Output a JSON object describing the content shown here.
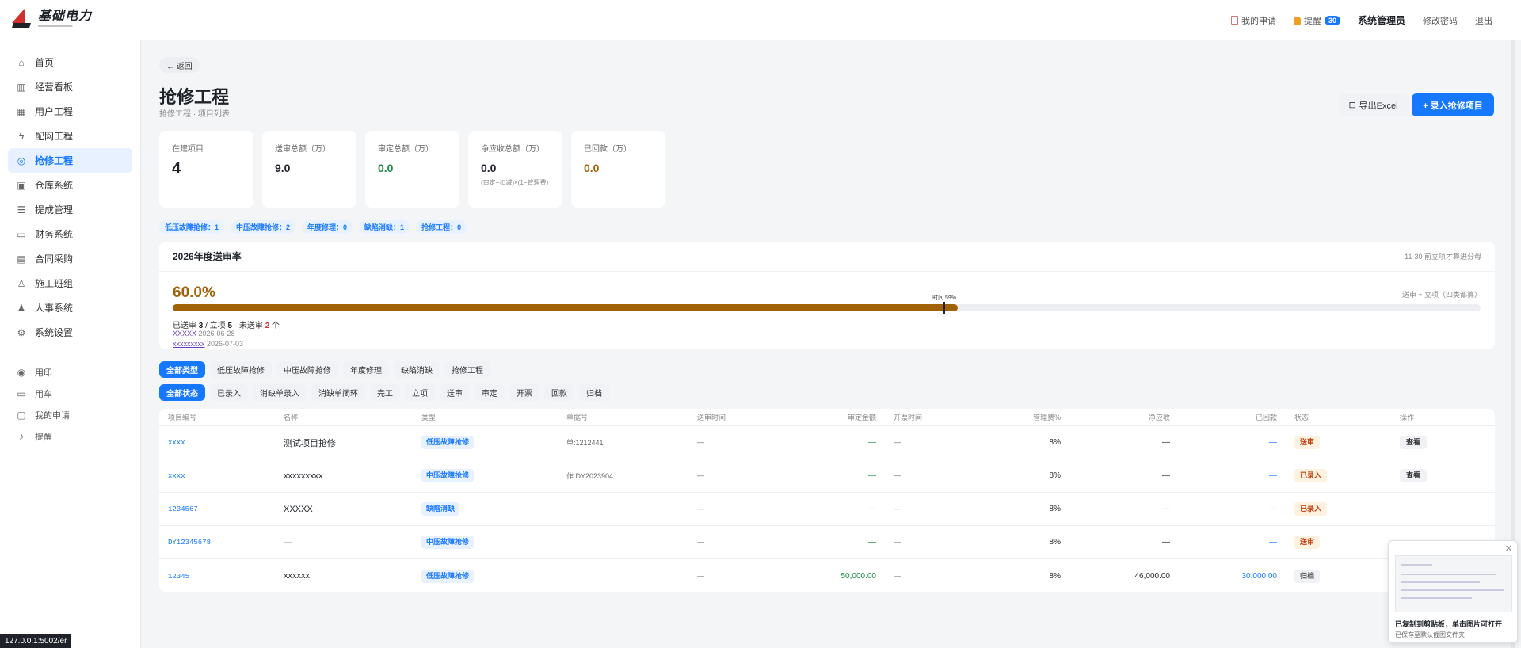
{
  "brand": {
    "name": "基础电力"
  },
  "topbar": {
    "my_requests": "我的申请",
    "reminders": "提醒",
    "reminder_count": "30",
    "user": "系统管理员",
    "change_password": "修改密码",
    "logout": "退出"
  },
  "sidebar": {
    "items": [
      {
        "label": "首页",
        "icon": "home-icon",
        "glyph": "⌂"
      },
      {
        "label": "经营看板",
        "icon": "chart-icon",
        "glyph": "▥"
      },
      {
        "label": "用户工程",
        "icon": "building-icon",
        "glyph": "▦"
      },
      {
        "label": "配网工程",
        "icon": "bolt-icon",
        "glyph": "ϟ"
      },
      {
        "label": "抢修工程",
        "icon": "shield-icon",
        "glyph": "◎"
      },
      {
        "label": "仓库系统",
        "icon": "box-icon",
        "glyph": "▣"
      },
      {
        "label": "提成管理",
        "icon": "list-icon",
        "glyph": "☰"
      },
      {
        "label": "财务系统",
        "icon": "money-icon",
        "glyph": "▭"
      },
      {
        "label": "合同采购",
        "icon": "document-icon",
        "glyph": "▤"
      },
      {
        "label": "施工班组",
        "icon": "team-icon",
        "glyph": "♙"
      },
      {
        "label": "人事系统",
        "icon": "person-add-icon",
        "glyph": "♟"
      },
      {
        "label": "系统设置",
        "icon": "gear-icon",
        "glyph": "⚙"
      }
    ],
    "sub_items": [
      {
        "label": "用印",
        "icon": "seal-icon",
        "glyph": "◉"
      },
      {
        "label": "用车",
        "icon": "car-icon",
        "glyph": "▭"
      },
      {
        "label": "我的申请",
        "icon": "clipboard-icon",
        "glyph": "▢"
      },
      {
        "label": "提醒",
        "icon": "bell-icon",
        "glyph": "♪"
      }
    ]
  },
  "page": {
    "back": "← 返回",
    "title": "抢修工程",
    "subtitle": "抢修工程 · 项目列表",
    "export_label": "导出Excel",
    "add_label": "+ 录入抢修项目"
  },
  "stats": [
    {
      "label": "在建项目",
      "value": "4"
    },
    {
      "label": "送审总额（万）",
      "value": "9.0"
    },
    {
      "label": "审定总额（万）",
      "value": "0.0"
    },
    {
      "label": "净应收总额（万）",
      "value": "0.0",
      "note": "(审定−扣减)×(1−管理费)"
    },
    {
      "label": "已回款（万）",
      "value": "0.0"
    }
  ],
  "chips": [
    "低压故障抢修：1",
    "中压故障抢修：2",
    "年度修理：0",
    "缺陷消缺：1",
    "抢修工程：0"
  ],
  "rate": {
    "title": "2026年度送审率",
    "hint": "11-30 前立项才算进分母",
    "percent": "60.0%",
    "progress_fraction": 0.6,
    "time_fraction": 0.59,
    "time_label": "时间 59%",
    "right_label": "送审 ÷ 立项（四类都算）",
    "summary_prefix": "已送审 ",
    "submitted": "3",
    "summary_mid": " / 立项 ",
    "projects": "5",
    "summary_mid2": " · 未送审 ",
    "pending": "2",
    "summary_suffix": " 个",
    "entries": [
      {
        "name": "XXXXX",
        "date": "2026-06-28"
      },
      {
        "name": "xxxxxxxxx",
        "date": "2026-07-03"
      }
    ]
  },
  "type_tabs": [
    "全部类型",
    "低压故障抢修",
    "中压故障抢修",
    "年度修理",
    "缺陷消缺",
    "抢修工程"
  ],
  "status_tabs": [
    "全部状态",
    "已录入",
    "消缺单录入",
    "消缺单闭环",
    "完工",
    "立项",
    "送审",
    "审定",
    "开票",
    "回款",
    "归档"
  ],
  "table": {
    "headers": [
      "项目编号",
      "名称",
      "类型",
      "单据号",
      "送审时间",
      "审定金额",
      "开票时间",
      "管理费%",
      "净应收",
      "已回款",
      "状态",
      "操作"
    ],
    "rows": [
      {
        "code": "xxxx",
        "name": "测试项目抢修",
        "type": "低压故障抢修",
        "doc": "单:1212441",
        "submit_time": "—",
        "approved": "—",
        "invoice_time": "—",
        "fee": "8%",
        "net": "—",
        "received": "—",
        "status": "送审",
        "action": "查看"
      },
      {
        "code": "xxxx",
        "name": "xxxxxxxxx",
        "type": "中压故障抢修",
        "doc": "作:DY2023904",
        "submit_time": "—",
        "approved": "—",
        "invoice_time": "—",
        "fee": "8%",
        "net": "—",
        "received": "—",
        "status": "已录入",
        "action": "查看"
      },
      {
        "code": "1234567",
        "name": "XXXXX",
        "type": "缺陷消缺",
        "doc": "",
        "submit_time": "—",
        "approved": "—",
        "invoice_time": "—",
        "fee": "8%",
        "net": "—",
        "received": "—",
        "status": "已录入",
        "action": ""
      },
      {
        "code": "DY12345678",
        "name": "—",
        "type": "中压故障抢修",
        "doc": "",
        "submit_time": "—",
        "approved": "—",
        "invoice_time": "—",
        "fee": "8%",
        "net": "—",
        "received": "—",
        "status": "送审",
        "action": ""
      },
      {
        "code": "12345",
        "name": "xxxxxx",
        "type": "低压故障抢修",
        "doc": "",
        "submit_time": "—",
        "approved": "50,000.00",
        "invoice_time": "—",
        "fee": "8%",
        "net": "46,000.00",
        "received": "30,000.00",
        "status": "归档",
        "action": ""
      }
    ]
  },
  "toast": {
    "title": "已复制到剪贴板，单击图片可打开",
    "subtitle": "已保存至默认截图文件夹"
  },
  "status_url": "127.0.0.1:5002/er",
  "colors": {
    "accent": "#1677ff",
    "brown": "#a16207",
    "green": "#1a8a4a"
  }
}
